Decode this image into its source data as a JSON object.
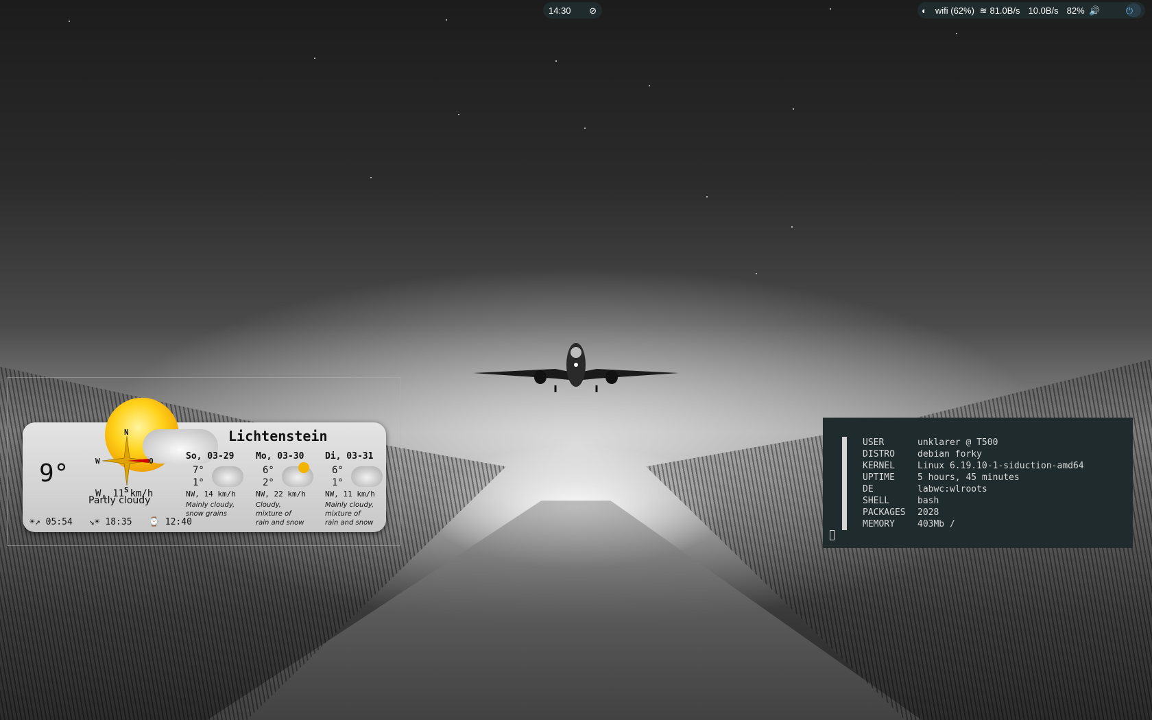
{
  "topbar": {
    "clock": "14:30",
    "eye_icon": "eye-off-icon",
    "wifi_text": "wifi (62%)",
    "download": "81.0B/s",
    "upload": "10.0B/s",
    "volume": "82%",
    "icons": [
      "monitor-icon",
      "wifi-icon",
      "speaker-icon",
      "power-icon"
    ]
  },
  "weather": {
    "location": "Lichtenstein",
    "current_temp": "9°",
    "current_wind": "W, 11 km/h",
    "current_condition": "Partly cloudy",
    "compass": {
      "n": "N",
      "s": "S",
      "w": "W",
      "o": "O"
    },
    "forecast": [
      {
        "date": "So, 03-29",
        "high": "7°",
        "low": "1°",
        "wind": "NW, 14 km/h",
        "desc1": "Mainly cloudy,",
        "desc2": "snow grains",
        "desc3": ""
      },
      {
        "date": "Mo, 03-30",
        "high": "6°",
        "low": "2°",
        "wind": "NW, 22 km/h",
        "desc1": "Cloudy,",
        "desc2": "mixture of",
        "desc3": "rain and snow"
      },
      {
        "date": "Di, 03-31",
        "high": "6°",
        "low": "1°",
        "wind": "NW, 11 km/h",
        "desc1": "Mainly cloudy,",
        "desc2": "mixture of",
        "desc3": "rain and snow"
      }
    ],
    "sunrise_icon": "☀↗",
    "sunrise": "05:54",
    "sunset_icon": "↘☀",
    "sunset": "18:35",
    "daylight_icon": "⌚",
    "daylight": "12:40"
  },
  "terminal": {
    "rows": [
      {
        "k": "USER",
        "v": "unklarer @ T500"
      },
      {
        "k": "DISTRO",
        "v": "debian forky"
      },
      {
        "k": "KERNEL",
        "v": "Linux 6.19.10-1-siduction-amd64"
      },
      {
        "k": "UPTIME",
        "v": "5 hours, 45 minutes"
      },
      {
        "k": "DE",
        "v": "labwc:wlroots"
      },
      {
        "k": "SHELL",
        "v": "bash"
      },
      {
        "k": "PACKAGES",
        "v": "2028"
      },
      {
        "k": "MEMORY",
        "v": "403Mb /"
      }
    ]
  }
}
